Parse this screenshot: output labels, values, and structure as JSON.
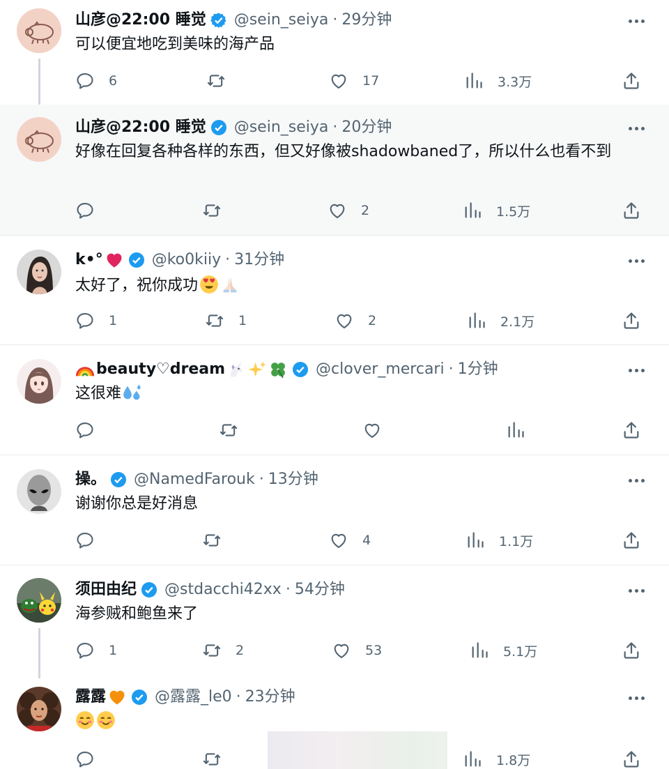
{
  "feed": {
    "tweets": [
      {
        "name": "山彦@22:00 睡觉",
        "handle": "@sein_seiya",
        "time": "29分钟",
        "text": "可以便宜地吃到美味的海产品",
        "replies": "6",
        "retweets": "",
        "likes": "17",
        "views": "3.3万",
        "avatar": "pig-avatar"
      },
      {
        "name": "山彦@22:00 睡觉",
        "handle": "@sein_seiya",
        "time": "20分钟",
        "text": "好像在回复各种各样的东西，但又好像被shadowbaned了，所以什么也看不到",
        "replies": "",
        "retweets": "",
        "likes": "2",
        "views": "1.5万",
        "avatar": "pig-avatar"
      },
      {
        "name": "k•°",
        "handle": "@ko0kiiy",
        "time": "31分钟",
        "text": "太好了，祝你成功",
        "name_emoji": [
          "red-heart"
        ],
        "text_emoji": [
          "heart-eyes-face",
          "folded-hands"
        ],
        "replies": "1",
        "retweets": "1",
        "likes": "2",
        "views": "2.1万",
        "avatar": "woman-avatar"
      },
      {
        "name": "beauty♡dream",
        "handle": "@clover_mercari",
        "time": "1分钟",
        "text": "这很难",
        "name_emoji_before": [
          "rainbow"
        ],
        "name_emoji": [
          "unicorn",
          "sparkles",
          "four-leaf-clover"
        ],
        "text_emoji": [
          "sweat-droplets"
        ],
        "replies": "",
        "retweets": "",
        "likes": "",
        "views": "",
        "avatar": "anime-girl-avatar"
      },
      {
        "name": "操。",
        "handle": "@NamedFarouk",
        "time": "13分钟",
        "text": "谢谢你总是好消息",
        "replies": "",
        "retweets": "",
        "likes": "4",
        "views": "1.1万",
        "avatar": "alien-avatar"
      },
      {
        "name": "须田由纪",
        "handle": "@stdacchi42xx",
        "time": "54分钟",
        "text": "海参贼和鲍鱼来了",
        "replies": "1",
        "retweets": "2",
        "likes": "53",
        "views": "5.1万",
        "avatar": "toys-avatar"
      },
      {
        "name": "露露",
        "handle": "@露露_le0",
        "time": "23分钟",
        "text": "",
        "name_emoji": [
          "orange-heart"
        ],
        "text_emoji": [
          "smiling-face",
          "smiling-face"
        ],
        "replies": "",
        "retweets": "",
        "likes": "",
        "views": "1.8万",
        "avatar": "curly-hair-avatar"
      }
    ]
  },
  "colors": {
    "verified": "#1d9bf0",
    "muted": "#536471",
    "text": "#0f1419",
    "highlight_bg": "#f7f8f8"
  }
}
